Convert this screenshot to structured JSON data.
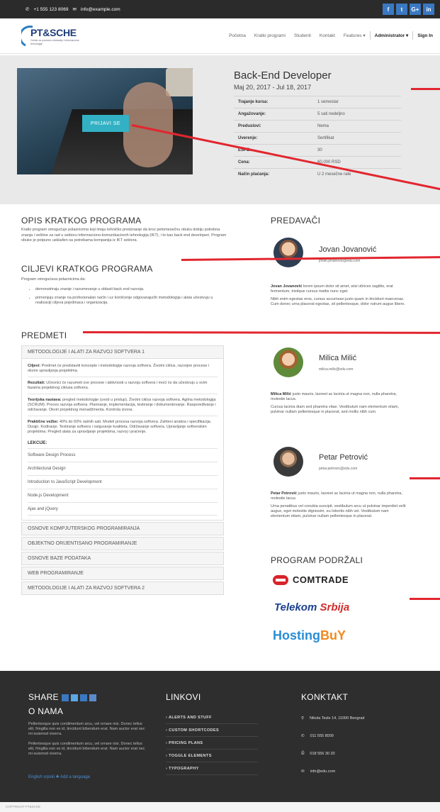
{
  "topbar": {
    "phone": "+1 555 123 8069",
    "email": "info@example.com",
    "social": [
      "f",
      "t",
      "G+",
      "in"
    ]
  },
  "nav": {
    "logo_title": "PT&SCHE",
    "logo_sub": "Centar za poslovnu edukaciju i informacione tehnologije",
    "items": [
      "Početna",
      "Kratki programi",
      "Studenti",
      "Kontakt",
      "Features ▾",
      "Administrator ▾",
      "Sign In"
    ]
  },
  "hero": {
    "apply": "PRIJAVI SE",
    "title": "Back-End Developer",
    "date": "Maj 20, 2017 - Jul 18, 2017",
    "details": [
      {
        "k": "Trajanje kursa:",
        "v": "1 semestar"
      },
      {
        "k": "Angažovanje:",
        "v": "5 sati nedeljno"
      },
      {
        "k": "Preduslovi:",
        "v": "Nema"
      },
      {
        "k": "Uverenje:",
        "v": "Sertifikat"
      },
      {
        "k": "ESPB:",
        "v": "30"
      },
      {
        "k": "Cena:",
        "v": "60.000 RSD"
      },
      {
        "k": "Način plaćanja:",
        "v": "U 2 mesečne rate"
      }
    ]
  },
  "about": {
    "title": "OPIS KRATKOG PROGRAMA",
    "text": "Kratki program omogućuje polaznicima koji imaju tehničko predznanje da kroz petomesečnu obuku dobiju potrebna znanja i veštine za rad u sektoru informaciono-komunikacionih tehnologija (IKT), i to kao back end developeri. Program obuke je potpuno usklađen sa potrebama kompanija iz IKT sektora."
  },
  "goals": {
    "title": "CILJEVI KRATKOG PROGRAMA",
    "intro": "Program  omogućava polaznicima da:",
    "items": [
      "demonstriraju znanje i razumevanje u oblasti back end razvoja.",
      "primenjuju znanje na profesionalan način i uz korišćenje odgovarajućih metodologija i alata učestvuju u realizaciji ciljeva pojedinaca i organizacija."
    ]
  },
  "subjects": {
    "title": "PREDMETI",
    "open": "METODOLOGIJE I ALATI ZA RAZVOJ SOFTVERA 1",
    "blocks": [
      {
        "b": "Ciljevi:",
        "t": "Predmet će predstaviti koncepte i metodologije razvoja softvera. Životni ciklus, razvojne procese i okvire upravljanja projektima."
      },
      {
        "b": "Rezultati:",
        "t": "Učesnici će razumeti sve procese i aktivnosti u razvoju softvera i moći će da učestvuju u svim fazama projektnog ciklusa softvera."
      },
      {
        "b": "Teorijska nastava:",
        "t": "pregled metodologije (uvod u pristup). Životni ciklus razvoja softvera. Agilna metodologija (SCRUM). Proces razvoja softvera. Planiranje, implementacija, testiranje i dokumentovanje. Raspoređivanje i održavanje. Okviri projektnog menadžmenta. Kontrola izvora."
      },
      {
        "b": "Praktične vežbe:",
        "t": "40% do 60% radnih sati. Modeli procesa razvoja softvera. Zahtevi analiza i specifikacija. Dizajn. Kodiranje. Testiranje softvera i osiguranje kvaliteta. Održavanje softvera. Upravljanje softverskim projektima. Pregled alata za upravljanje projektima, razvoj i praćenje."
      }
    ],
    "lek": "LEKCIJE:",
    "lessons": [
      "Software Design Process",
      "Architectural Design",
      "Introduction to JavaScript Development",
      "Node.js Development",
      "Ajax and jQuery"
    ],
    "others": [
      "OSNOVE KOMPJUTERSKOG PROGRAMIRANJA",
      "OBJEKTNO ORIJENTISANO PROGRAMIRANJE",
      "OSNOVE BAZE PODATAKA",
      "WEB PROGRAMIRANJE",
      "METODOLOGIJE I ALATI ZA RAZVOJ SOFTVERA 2"
    ]
  },
  "lecturers": {
    "title": "PREDAVAČI",
    "people": [
      {
        "name": "Jovan Jovanović",
        "mail": "jovan.jovanovic@edu.com",
        "bold": "Jovan Jovanović",
        "d1": "lorem ipsum dolor sit amet, wisi ultrices sagittis, erat fermentum, tristique cursus mattis nunc eget.",
        "d2": "Nibh enim egestas eros, cursus accumsan justo quam in tincidunt maecenas. Cum donec urna placerat egestas, sit pellentesque, dolor rutrum augue libero."
      },
      {
        "name": "Milica Milić",
        "mail": "milica.milic@edu.com",
        "bold": "Milica Milić",
        "d1": "justo mauris, laoreet ac lacinia ut magna non, nulla pharetra, molestie lacus.",
        "d2": "Cursus lacinia diam sed pharetra vitae. Vestibulum nam elementum etiam, pulvinar nullam pellentesque in placerat, sed mollis nibh cum."
      },
      {
        "name": "Petar Petrović",
        "mail": "petar.petrovic@edu.com",
        "bold": "Petar Petrović",
        "d1": "justo mauris, laoreet ac lacinia ut magna non, nulla pharetra, molestie lacus.",
        "d2": "Urna penatibus vel conubia suscipit, vestibulum arcu ut pulvinar imperdiet velit augue, eget molestie dignissim, eu lobortis nibh vel. Vestibulum nam elementum etiam, pulvinar nullam pellentesque in placerat."
      }
    ]
  },
  "sponsors": {
    "title": "PROGRAM PODRŽALI",
    "s1": "COMTRADE",
    "s2a": "Telekom",
    "s2b": "Srbija",
    "s3a": "Hosting",
    "s3b": "BuY"
  },
  "footer": {
    "share": "SHARE",
    "about": "O NAMA",
    "p1": "Pellentesque quis condimentum arcu, vel ornare nisi. Donec tellus elit, fringilla non ex id, tincidunt bibendum erat. Nam auctor erat nec mi euismod viverra.",
    "p2": "Pellentesque quis condimentum arcu, vel ornare nisi. Donec tellus elit, fringilla non ex id, tincidunt bibendum erat. Nam auctor erat nec mi euismod viverra.",
    "lang": "English  srpski  ✚ Add a language",
    "links_title": "LINKOVI",
    "links": [
      "› ALERTS AND STUFF",
      "› CUSTOM SHORTCODES",
      "› PRICING PLANS",
      "› TOGGLE ELEMENTS",
      "› TYPOGRAPHY"
    ],
    "contact_title": "KONKTAKT",
    "contacts": [
      {
        "i": "⚲",
        "t": "Nikola Tesle 14, 11000 Beograd"
      },
      {
        "i": "✆",
        "t": "011 555 8009"
      },
      {
        "i": "⎙",
        "t": "018 556 30 20"
      },
      {
        "i": "✉",
        "t": "info@edu.com"
      }
    ],
    "copy": "COPYRIGHT PT&SCHE"
  },
  "colors": {
    "accent": "#33b1c4",
    "red": "#e2262f",
    "footer": "#2e2e2e"
  }
}
